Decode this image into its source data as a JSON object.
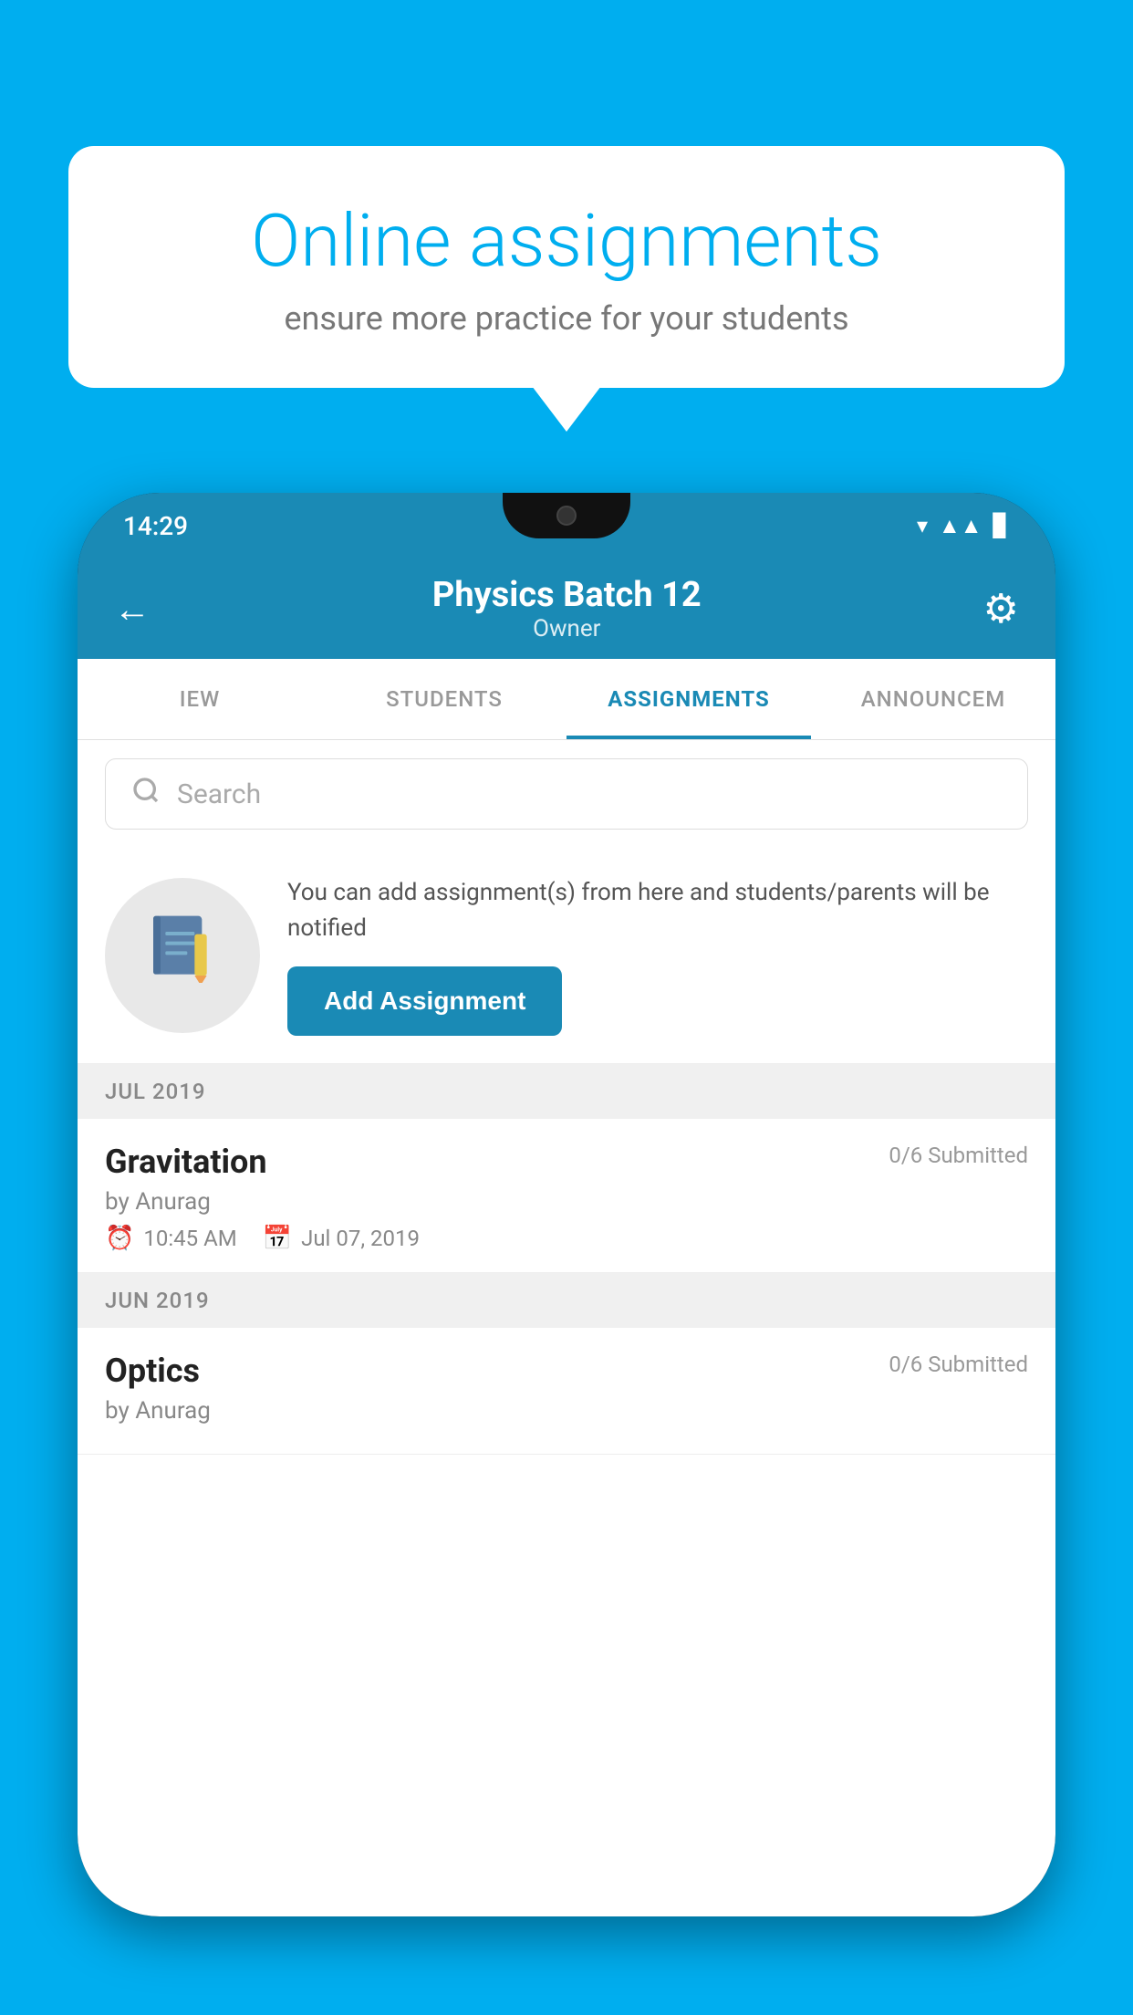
{
  "background_color": "#00AEEF",
  "speech_bubble": {
    "title": "Online assignments",
    "subtitle": "ensure more practice for your students"
  },
  "phone": {
    "status_bar": {
      "time": "14:29",
      "icons": [
        "wifi",
        "signal",
        "battery"
      ]
    },
    "header": {
      "title": "Physics Batch 12",
      "subtitle": "Owner",
      "back_label": "←",
      "settings_label": "⚙"
    },
    "tabs": [
      {
        "label": "IEW",
        "active": false
      },
      {
        "label": "STUDENTS",
        "active": false
      },
      {
        "label": "ASSIGNMENTS",
        "active": true
      },
      {
        "label": "ANNOUNCEM",
        "active": false
      }
    ],
    "search": {
      "placeholder": "Search"
    },
    "promo": {
      "description": "You can add assignment(s) from here and students/parents will be notified",
      "button_label": "Add Assignment"
    },
    "sections": [
      {
        "month_label": "JUL 2019",
        "assignments": [
          {
            "name": "Gravitation",
            "submitted": "0/6 Submitted",
            "by": "by Anurag",
            "time": "10:45 AM",
            "date": "Jul 07, 2019"
          }
        ]
      },
      {
        "month_label": "JUN 2019",
        "assignments": [
          {
            "name": "Optics",
            "submitted": "0/6 Submitted",
            "by": "by Anurag",
            "time": "",
            "date": ""
          }
        ]
      }
    ]
  }
}
